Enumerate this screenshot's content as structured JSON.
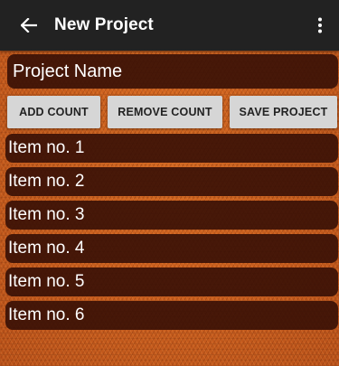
{
  "toolbar": {
    "title": "New Project",
    "back_icon": "arrow-left-icon",
    "menu_icon": "more-vert-icon"
  },
  "project_name": {
    "value": "Project Name"
  },
  "buttons": {
    "add_label": "ADD COUNT",
    "remove_label": "REMOVE COUNT",
    "save_label": "SAVE PROJECT"
  },
  "items": [
    {
      "label": "Item no. 1"
    },
    {
      "label": "Item no. 2"
    },
    {
      "label": "Item no. 3"
    },
    {
      "label": "Item no. 4"
    },
    {
      "label": "Item no. 5"
    },
    {
      "label": "Item no. 6"
    }
  ],
  "colors": {
    "toolbar": "#222222",
    "row_bg": "#37100a",
    "button_bg": "#d6d6d6",
    "background": "#c55c18"
  }
}
